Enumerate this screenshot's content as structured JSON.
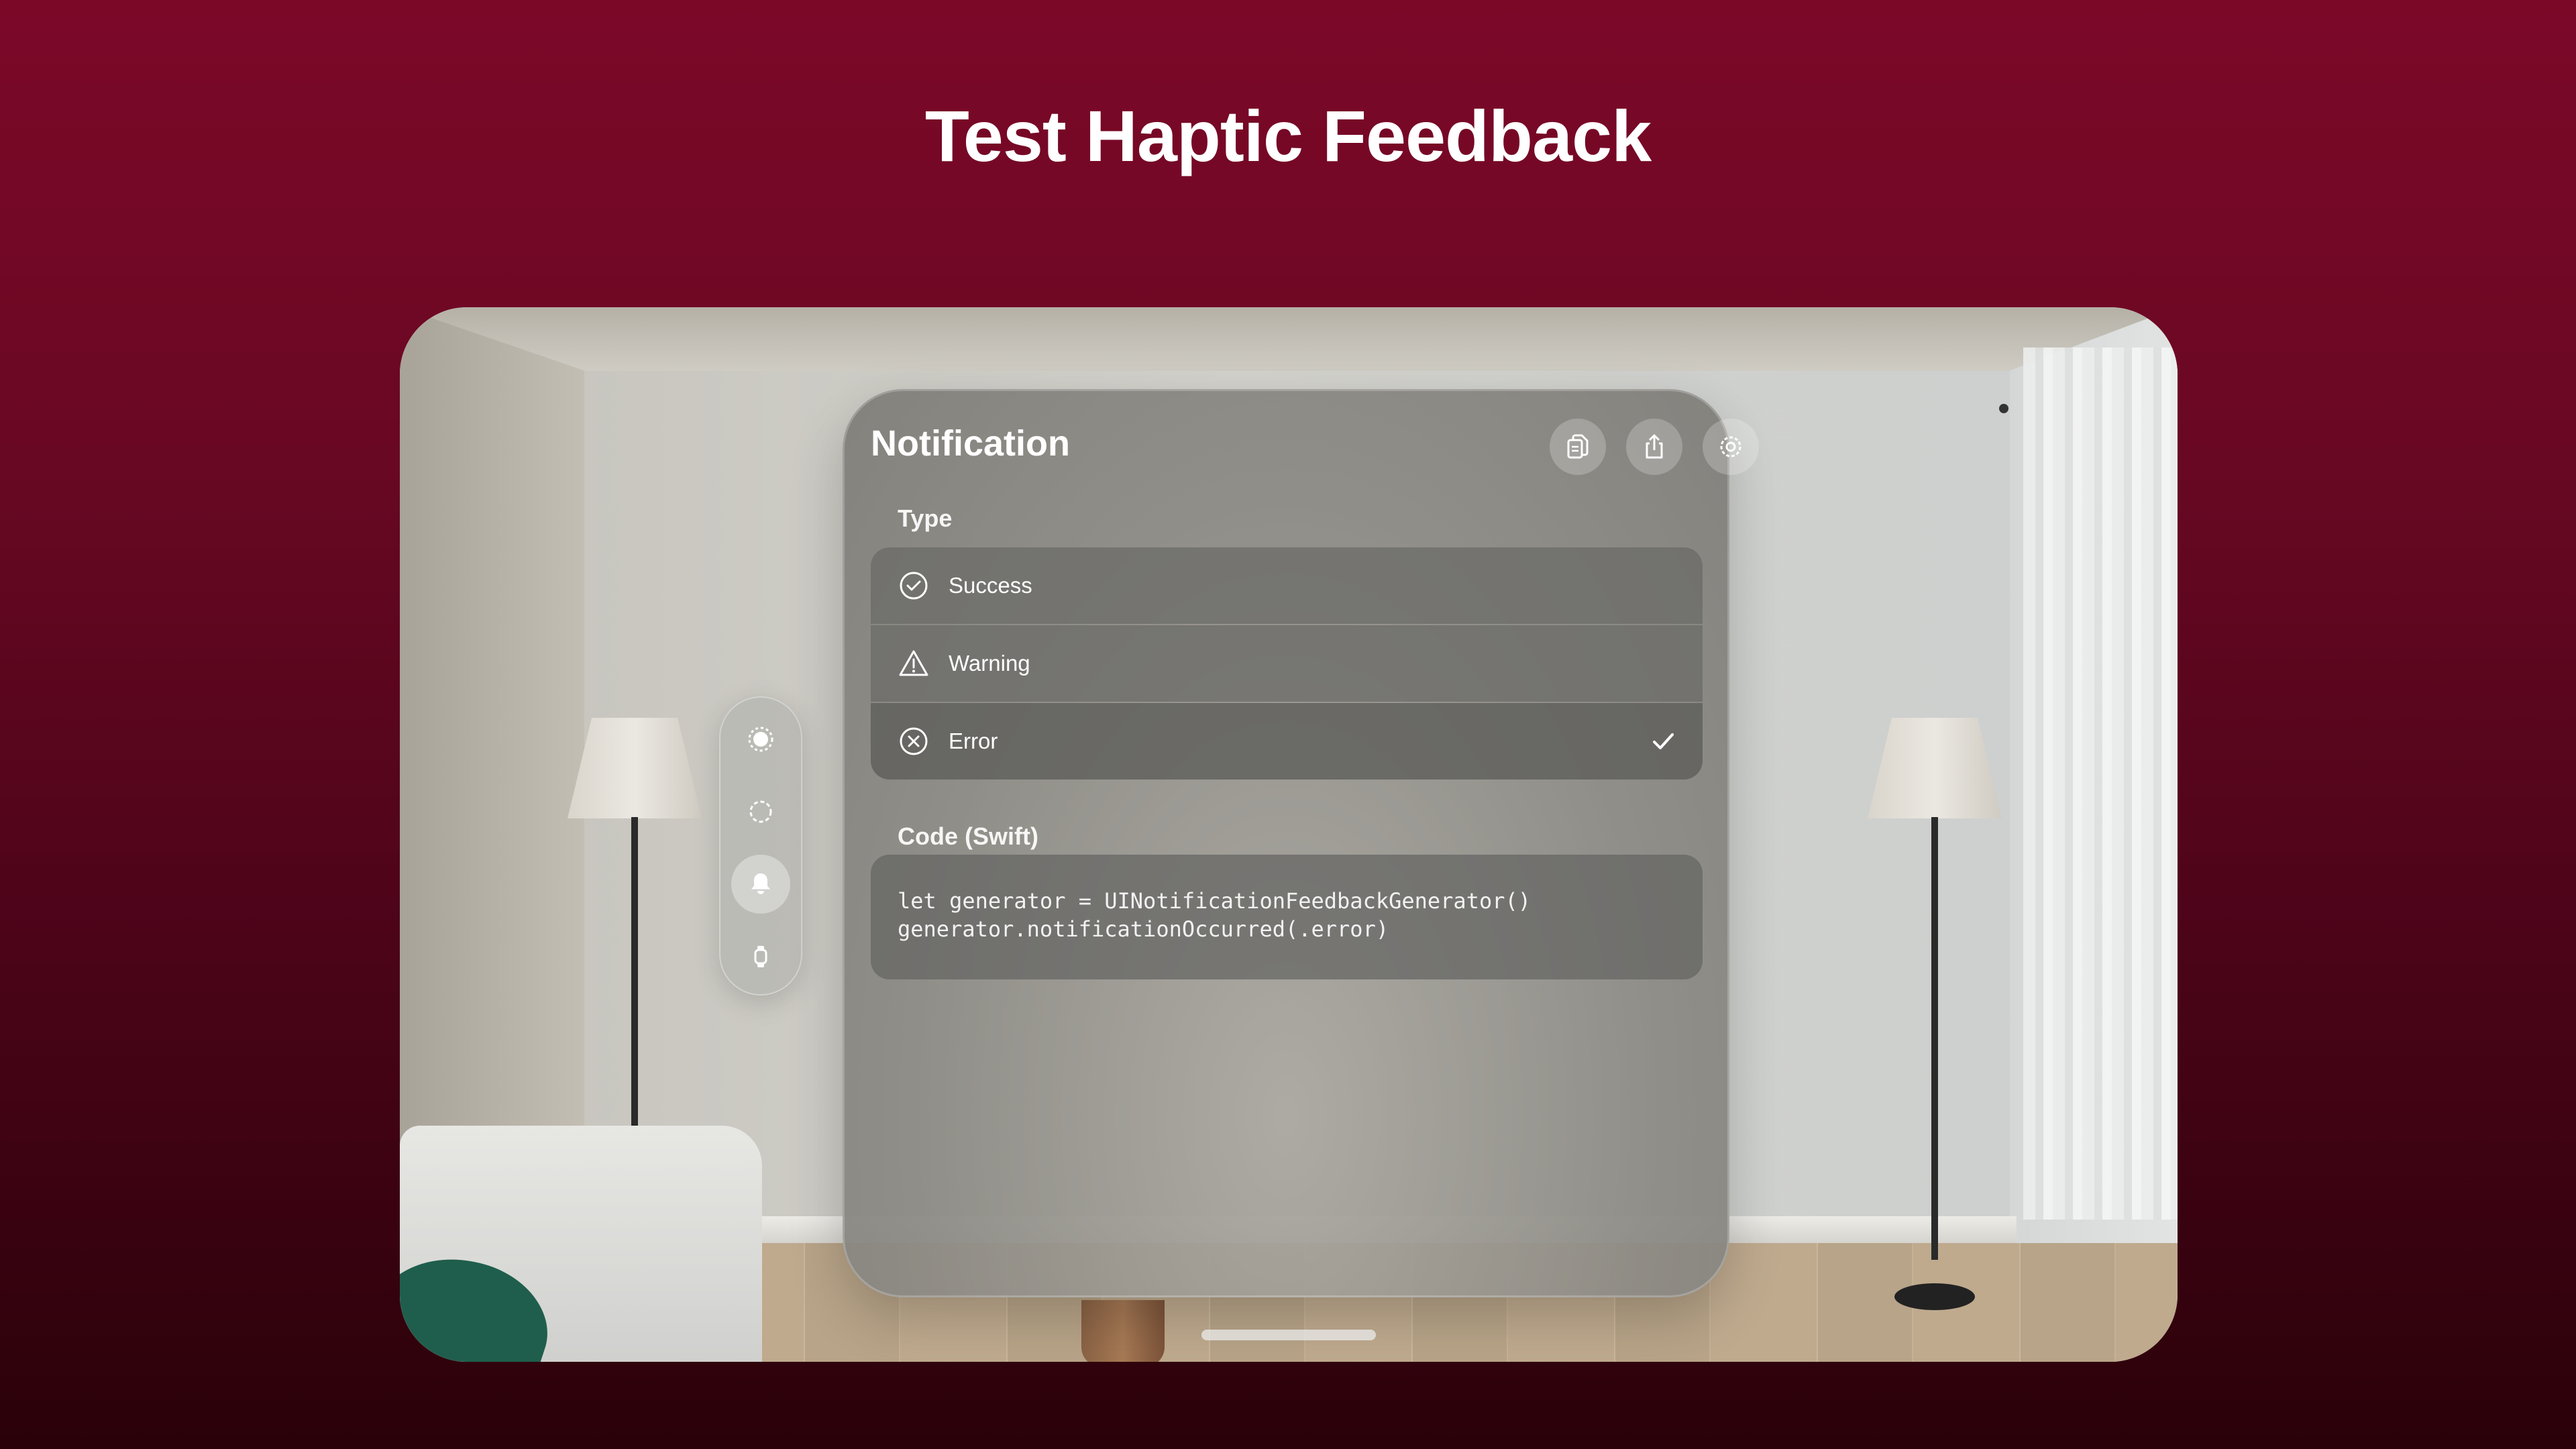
{
  "headline": "Test Haptic Feedback",
  "window": {
    "title": "Notification",
    "toolbar": {
      "copy_icon": "copy-document-icon",
      "share_icon": "share-icon",
      "settings_icon": "gear-icon"
    },
    "type_section_label": "Type",
    "type_options": [
      {
        "label": "Success",
        "icon": "checkmark-circle-icon",
        "selected": false
      },
      {
        "label": "Warning",
        "icon": "warning-triangle-icon",
        "selected": false
      },
      {
        "label": "Error",
        "icon": "xmark-circle-icon",
        "selected": true
      }
    ],
    "code_section_label": "Code (Swift)",
    "code_lines": [
      "let generator = UINotificationFeedbackGenerator()",
      "generator.notificationOccurred(.error)"
    ]
  },
  "ornament": {
    "items": [
      {
        "icon": "impact-icon",
        "active": false
      },
      {
        "icon": "selection-icon",
        "active": false
      },
      {
        "icon": "bell-icon",
        "active": true
      },
      {
        "icon": "watch-icon",
        "active": false
      }
    ]
  },
  "colors": {
    "background_top": "#7c0828",
    "background_bottom": "#2a0109",
    "text": "#ffffff"
  }
}
